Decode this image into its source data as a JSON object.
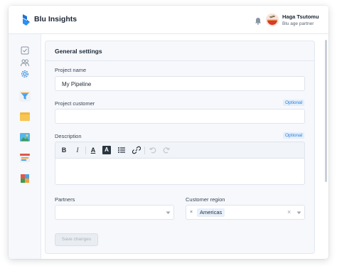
{
  "app": {
    "brand": "Blu Insights"
  },
  "user": {
    "name": "Haga Tsutomu",
    "role": "Blu age partner"
  },
  "sidebar": {
    "items": [
      {
        "icon": "checklist-icon"
      },
      {
        "icon": "users-icon"
      },
      {
        "icon": "gear-icon",
        "active": true
      },
      {
        "icon": "filter-icon"
      },
      {
        "icon": "folder-icon"
      },
      {
        "icon": "image-icon"
      },
      {
        "icon": "browser-icon"
      },
      {
        "icon": "puzzle-icon"
      }
    ]
  },
  "general_settings": {
    "title": "General settings",
    "project_name": {
      "label": "Project name",
      "value": "My Pipeline"
    },
    "project_customer": {
      "label": "Project customer",
      "badge": "Optional",
      "value": ""
    },
    "description": {
      "label": "Description",
      "badge": "Optional",
      "toolbar": {
        "bold": "B",
        "italic": "I",
        "text_color": "A",
        "highlight": "A"
      },
      "value": ""
    },
    "partners": {
      "label": "Partners",
      "value": ""
    },
    "customer_region": {
      "label": "Customer region",
      "selected": "Americas",
      "remove": "×",
      "clear": "×"
    },
    "save_label": "Save changes"
  },
  "colors": {
    "accent": "#2f7fd6",
    "active_icon": "#3b8ee6",
    "background": "#f6f8fc"
  }
}
